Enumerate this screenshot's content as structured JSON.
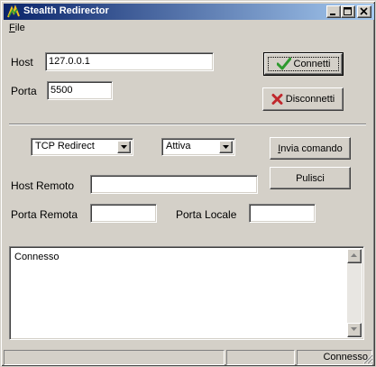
{
  "window": {
    "title": "Stealth Redirector",
    "controls": {
      "minimize": "minimize-icon",
      "maximize": "maximize-icon",
      "close": "close-icon"
    }
  },
  "menu": {
    "file": "File"
  },
  "connection": {
    "host_label": "Host",
    "host_value": "127.0.0.1",
    "port_label": "Porta",
    "port_value": "5500",
    "connect_label": "Connetti",
    "disconnect_label": "Disconnetti"
  },
  "redirect": {
    "mode_selected": "TCP Redirect",
    "state_selected": "Attiva",
    "send_command_label": "Invia comando",
    "clear_label": "Pulisci",
    "remote_host_label": "Host Remoto",
    "remote_host_value": "",
    "remote_port_label": "Porta Remota",
    "remote_port_value": "",
    "local_port_label": "Porta Locale",
    "local_port_value": ""
  },
  "log": {
    "text": "Connesso"
  },
  "statusbar": {
    "panel1": "",
    "panel2": "",
    "status": "Connesso"
  },
  "colors": {
    "titlebar_start": "#0a246a",
    "titlebar_end": "#a6caf0",
    "face": "#d4d0c8",
    "connect_check": "#2e9a2e",
    "disconnect_x": "#c0282d"
  }
}
